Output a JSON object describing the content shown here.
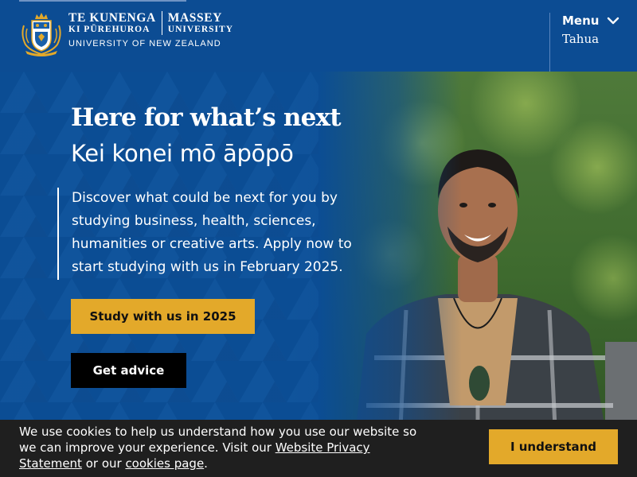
{
  "header": {
    "logo": {
      "line1_left": "TE KUNENGA",
      "line1_right": "MASSEY",
      "line2_left": "KI PŪREHUROA",
      "line2_right": "UNIVERSITY",
      "line3": "UNIVERSITY OF NEW ZEALAND",
      "crest_icon": "university-crest-icon"
    },
    "menu": {
      "label": "Menu",
      "icon": "chevron-down-icon"
    },
    "secondary_link": "Tahua"
  },
  "hero": {
    "headline": "Here for what’s next",
    "subheadline": "Kei konei mō āpōpō",
    "description": "Discover what could be next for you by studying business, health, sciences, humanities or creative arts. Apply now to start studying with us in February 2025.",
    "primary_button": "Study with us in 2025",
    "secondary_button": "Get advice"
  },
  "cookie_banner": {
    "text_1": "We use cookies to help us understand how you use our website so we can improve your experience. Visit our ",
    "privacy_link": "Website Privacy Statement",
    "text_2": " or our ",
    "cookies_link": "cookies page",
    "text_3": ".",
    "accept_button": "I understand"
  },
  "colors": {
    "brand_blue": "#0c4c93",
    "accent_gold": "#e3a92a",
    "banner_dark": "#1f1f1f"
  }
}
